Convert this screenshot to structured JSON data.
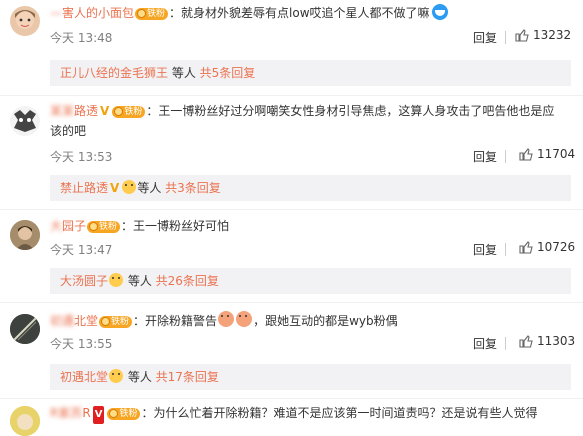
{
  "comments": [
    {
      "name_prefix": "—",
      "name": "害人的小面包",
      "badge": "铁粉",
      "text": "：就身材外貌差辱有点low哎追个星人都不做了嘛",
      "time": "今天 13:48",
      "reply": "回复",
      "likes": "13232",
      "sub_name": "正儿八经的金毛狮王",
      "sub_mid": " 等人 ",
      "sub_more": "共5条回复"
    },
    {
      "name": "路透",
      "badge": "铁粉",
      "text": "：王一博粉丝好过分啊嘲笑女性身材引导焦虑，这算人身攻击了吧告他也是应",
      "text2": "该的吧",
      "time": "今天 13:53",
      "reply": "回复",
      "likes": "11704",
      "sub_name": "禁止路透",
      "sub_mid": "等人 ",
      "sub_more": "共3条回复"
    },
    {
      "name": "园子",
      "badge": "铁粉",
      "text": "：王一博粉丝好可怕",
      "time": "今天 13:47",
      "reply": "回复",
      "likes": "10726",
      "sub_name": "大汤圆子",
      "sub_mid": " 等人 ",
      "sub_more": "共26条回复"
    },
    {
      "name": "北堂",
      "badge": "铁粉",
      "text_a": "：开除粉籍警告",
      "text_b": "，跟她互动的都是wyb粉偶",
      "time": "今天 13:55",
      "reply": "回复",
      "likes": "11303",
      "sub_name": "初遇北堂",
      "sub_mid": " 等人 ",
      "sub_more": "共17条回复"
    },
    {
      "name": "R",
      "badge": "铁粉",
      "text": "：为什么忙着开除粉籍？难道不是应该第一时间道责吗？还是说有些人觉得"
    }
  ]
}
